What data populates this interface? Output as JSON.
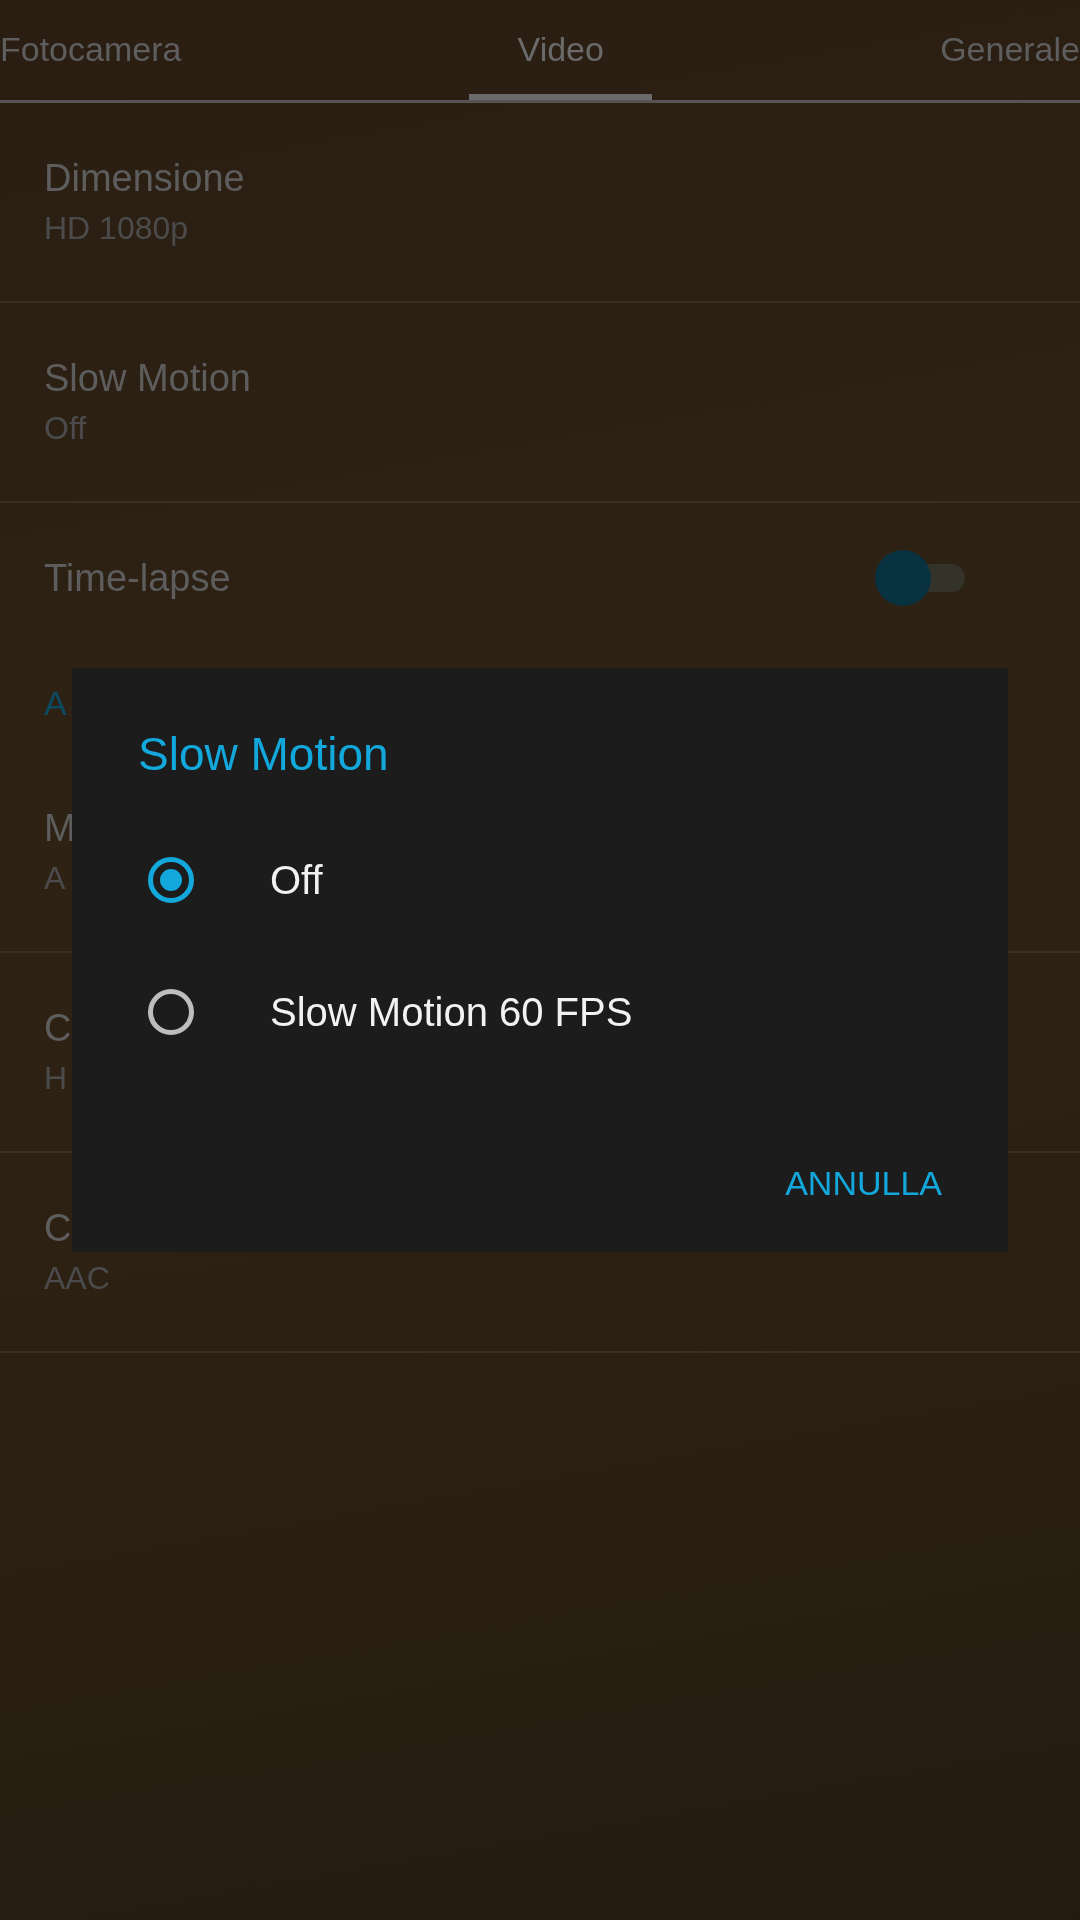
{
  "tabs": [
    {
      "label": "Fotocamera",
      "selected": false
    },
    {
      "label": "Video",
      "selected": true
    },
    {
      "label": "Generale",
      "selected": false
    }
  ],
  "settings": [
    {
      "kind": "item",
      "title": "Dimensione",
      "value": "HD 1080p"
    },
    {
      "kind": "item",
      "title": "Slow Motion",
      "value": "Off"
    },
    {
      "kind": "switch",
      "title": "Time-lapse",
      "on": false
    },
    {
      "kind": "header",
      "title": "A"
    },
    {
      "kind": "item",
      "title": "M",
      "value": "A"
    },
    {
      "kind": "item",
      "title": "C",
      "value": "H"
    },
    {
      "kind": "item",
      "title": "C",
      "value": "AAC"
    }
  ],
  "dialog": {
    "title": "Slow Motion",
    "options": [
      {
        "label": "Off",
        "selected": true
      },
      {
        "label": "Slow Motion 60 FPS",
        "selected": false
      }
    ],
    "buttons": [
      "ANNULLA"
    ]
  }
}
